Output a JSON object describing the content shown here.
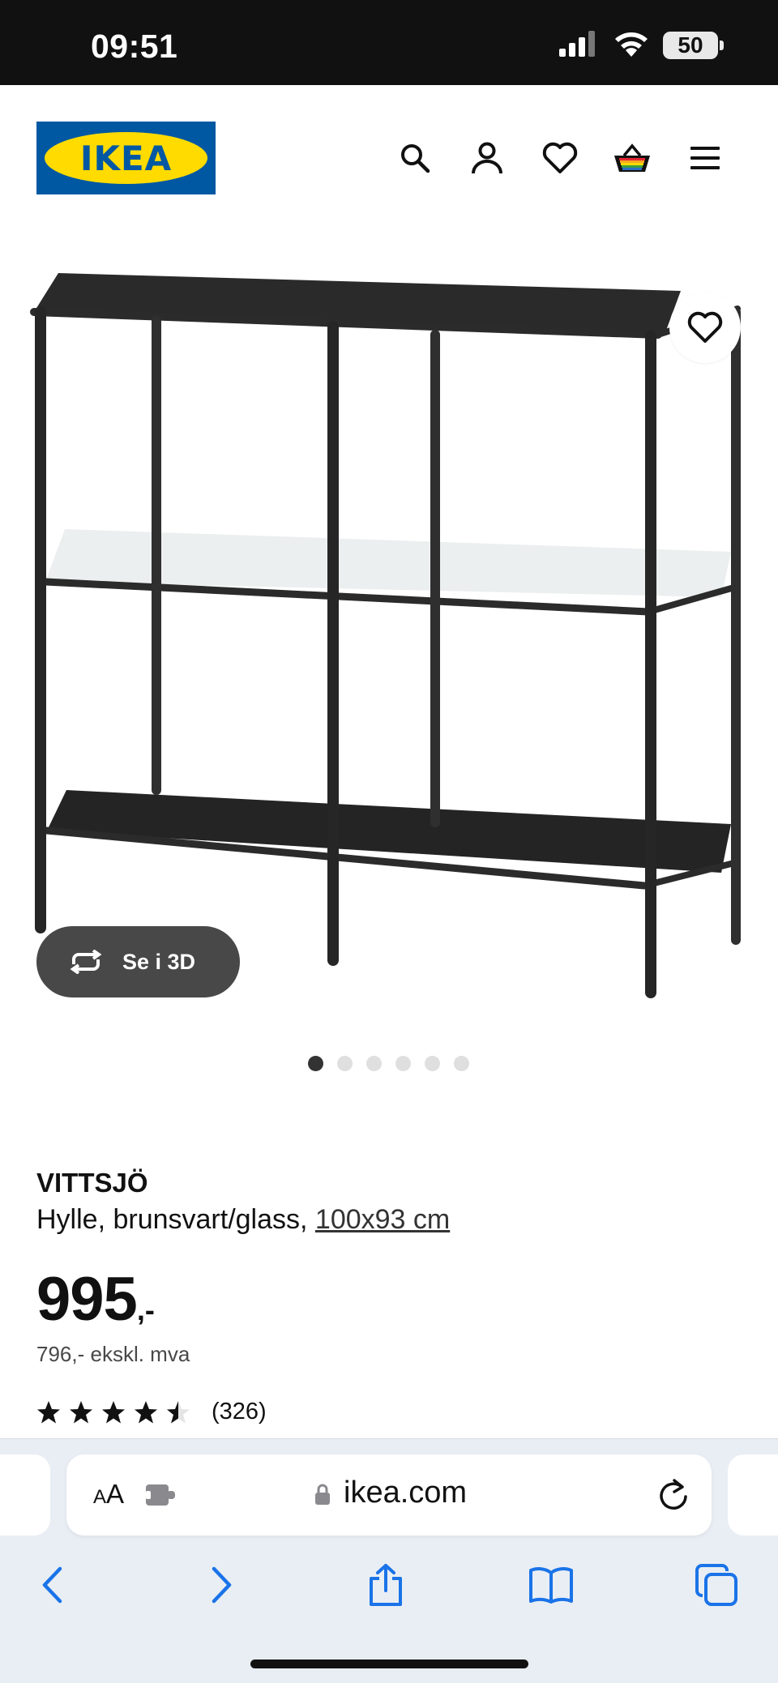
{
  "status_bar": {
    "time": "09:51",
    "battery": "50"
  },
  "header": {
    "logo_text": "IKEA",
    "icons": [
      "search-icon",
      "profile-icon",
      "heart-icon",
      "basket-icon",
      "menu-icon"
    ]
  },
  "gallery": {
    "view_3d_label": "Se i 3D",
    "total_images": 6,
    "active_index": 0
  },
  "product": {
    "name": "VITTSJÖ",
    "description": "Hylle, brunsvart/glass, ",
    "size": "100x93 cm",
    "price": "995",
    "price_suffix": ",-",
    "price_ex_vat": "796,- ekskl. mva",
    "rating": 4.5,
    "review_count": "(326)"
  },
  "browser": {
    "aa_small": "A",
    "aa_large": "A",
    "url": "ikea.com"
  },
  "colors": {
    "ikea_blue": "#0058a3",
    "ikea_yellow": "#ffdb00",
    "safari_blue": "#1a73e8"
  }
}
